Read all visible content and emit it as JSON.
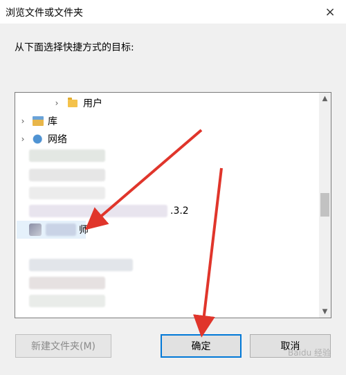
{
  "window": {
    "title": "浏览文件或文件夹",
    "close_glyph": "×"
  },
  "prompt": "从下面选择快捷方式的目标:",
  "tree": {
    "items": [
      {
        "label": "用户",
        "icon": "folder-icon",
        "expander": "›"
      },
      {
        "label": "库",
        "icon": "library-icon",
        "expander": "›"
      },
      {
        "label": "网络",
        "icon": "network-icon",
        "expander": "›"
      },
      {
        "label": ".3.2"
      },
      {
        "label": "师"
      }
    ]
  },
  "scrollbar": {
    "up": "▲",
    "down": "▼"
  },
  "buttons": {
    "new_folder": "新建文件夹(M)",
    "ok": "确定",
    "cancel": "取消"
  },
  "watermark": "Baidu 经验",
  "colors": {
    "accent": "#0078d7",
    "arrow": "#e0352b",
    "selection": "#e5f1fb"
  }
}
